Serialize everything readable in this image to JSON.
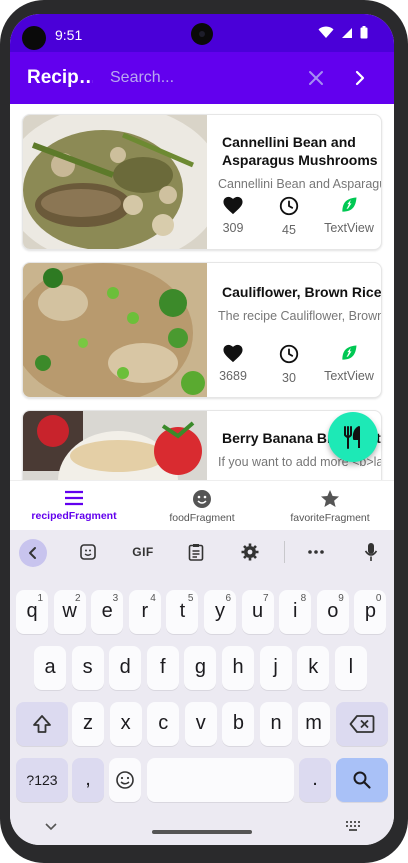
{
  "status_bar": {
    "time": "9:51"
  },
  "app_bar": {
    "title": "Recip…",
    "search_placeholder": "Search..."
  },
  "recipes": [
    {
      "title": "Cannellini Bean and Asparagus Mushrooms",
      "desc": "Cannellini Bean and Asparagus Mushrooms...",
      "likes": "309",
      "minutes": "45",
      "vegan_label": "TextView"
    },
    {
      "title": "Cauliflower, Brown Rice, and Vegetable Fried Rice",
      "desc": "The recipe Cauliflower, Brown Rice...",
      "likes": "3689",
      "minutes": "30",
      "vegan_label": "TextView"
    },
    {
      "title": "Berry Banana Breakfast Smoothie",
      "desc": "If you want to add more <b>la..."
    }
  ],
  "bottom_nav": [
    {
      "label": "recipedFragment",
      "icon": "list-icon"
    },
    {
      "label": "foodFragment",
      "icon": "smiley-icon"
    },
    {
      "label": "favoriteFragment",
      "icon": "star-icon"
    }
  ],
  "keyboard": {
    "toolbar": [
      "back-icon",
      "sticker-icon",
      "GIF",
      "clipboard-icon",
      "settings-icon",
      "more-icon",
      "mic-icon"
    ],
    "row1": [
      "q",
      "w",
      "e",
      "r",
      "t",
      "y",
      "u",
      "i",
      "o",
      "p"
    ],
    "row1_hints": [
      "1",
      "2",
      "3",
      "4",
      "5",
      "6",
      "7",
      "8",
      "9",
      "0"
    ],
    "row2": [
      "a",
      "s",
      "d",
      "f",
      "g",
      "h",
      "j",
      "k",
      "l"
    ],
    "row3": [
      "z",
      "x",
      "c",
      "v",
      "b",
      "n",
      "m"
    ],
    "symbols_label": "?123",
    "comma": ",",
    "period": "."
  },
  "colors": {
    "primary": "#6200ee",
    "status_bar": "#4a00d8",
    "fab": "#1de9b6",
    "vegan": "#00c853"
  }
}
